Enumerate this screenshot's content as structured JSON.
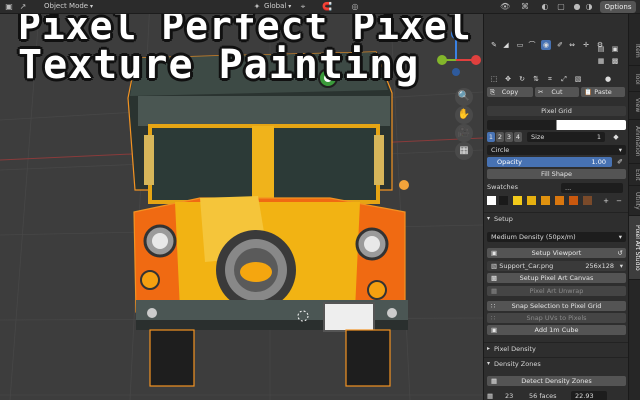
{
  "topbar": {
    "mode": "Object Mode",
    "transform": "Global",
    "options": "Options"
  },
  "overlay": {
    "line1": "Pixel Perfect Pixel Art",
    "line2": "Texture Painting"
  },
  "gizmo": {
    "axes": [
      {
        "label": "Y",
        "color": "#83b62b"
      },
      {
        "label": "X",
        "color": "#e0403e"
      },
      {
        "label": "Z",
        "color": "#3a82e4"
      }
    ],
    "buttons": [
      "zoom-icon",
      "hand-icon",
      "camera-icon",
      "grid-icon"
    ]
  },
  "panel": {
    "clipboard": {
      "copy": "Copy",
      "cut": "Cut",
      "paste": "Paste"
    },
    "brush": {
      "name": "Pixel Grid",
      "sizes": [
        "1",
        "2",
        "3",
        "4"
      ],
      "size_label": "Size",
      "size_value": "1"
    },
    "stroke": {
      "falloff": "Circle",
      "opacity_label": "Opacity",
      "opacity_value": "1.00",
      "fill": "Fill Shape"
    },
    "swatches": {
      "label": "Swatches",
      "dropdown": "...",
      "colors": [
        "#ffffff",
        "#1a1a1a",
        "#f2ca1b",
        "#e6b010",
        "#e0920f",
        "#d9770f",
        "#c9580e",
        "#7a4a2a"
      ]
    },
    "setup": {
      "title": "Setup",
      "density": "Medium Density (50px/m)",
      "setup_viewport": "Setup Viewport",
      "texture_name": "Support_Car.png",
      "texture_size": "256x128",
      "setup_canvas": "Setup Pixel Art Canvas",
      "unwrap": "Pixel Art Unwrap",
      "snap_selection": "Snap Selection to Pixel Grid",
      "snap_uvs": "Snap UVs to Pixels",
      "add_cube": "Add 1m Cube"
    },
    "pixel_density": {
      "title": "Pixel Density"
    },
    "density_zones": {
      "title": "Density Zones",
      "detect": "Detect Density Zones",
      "count": "23",
      "faces": "56 faces",
      "value": "22.93"
    }
  },
  "tabs": [
    "Item",
    "Tool",
    "View",
    "Animation",
    "Edit",
    "Utility",
    "Pixel Art Studio"
  ]
}
